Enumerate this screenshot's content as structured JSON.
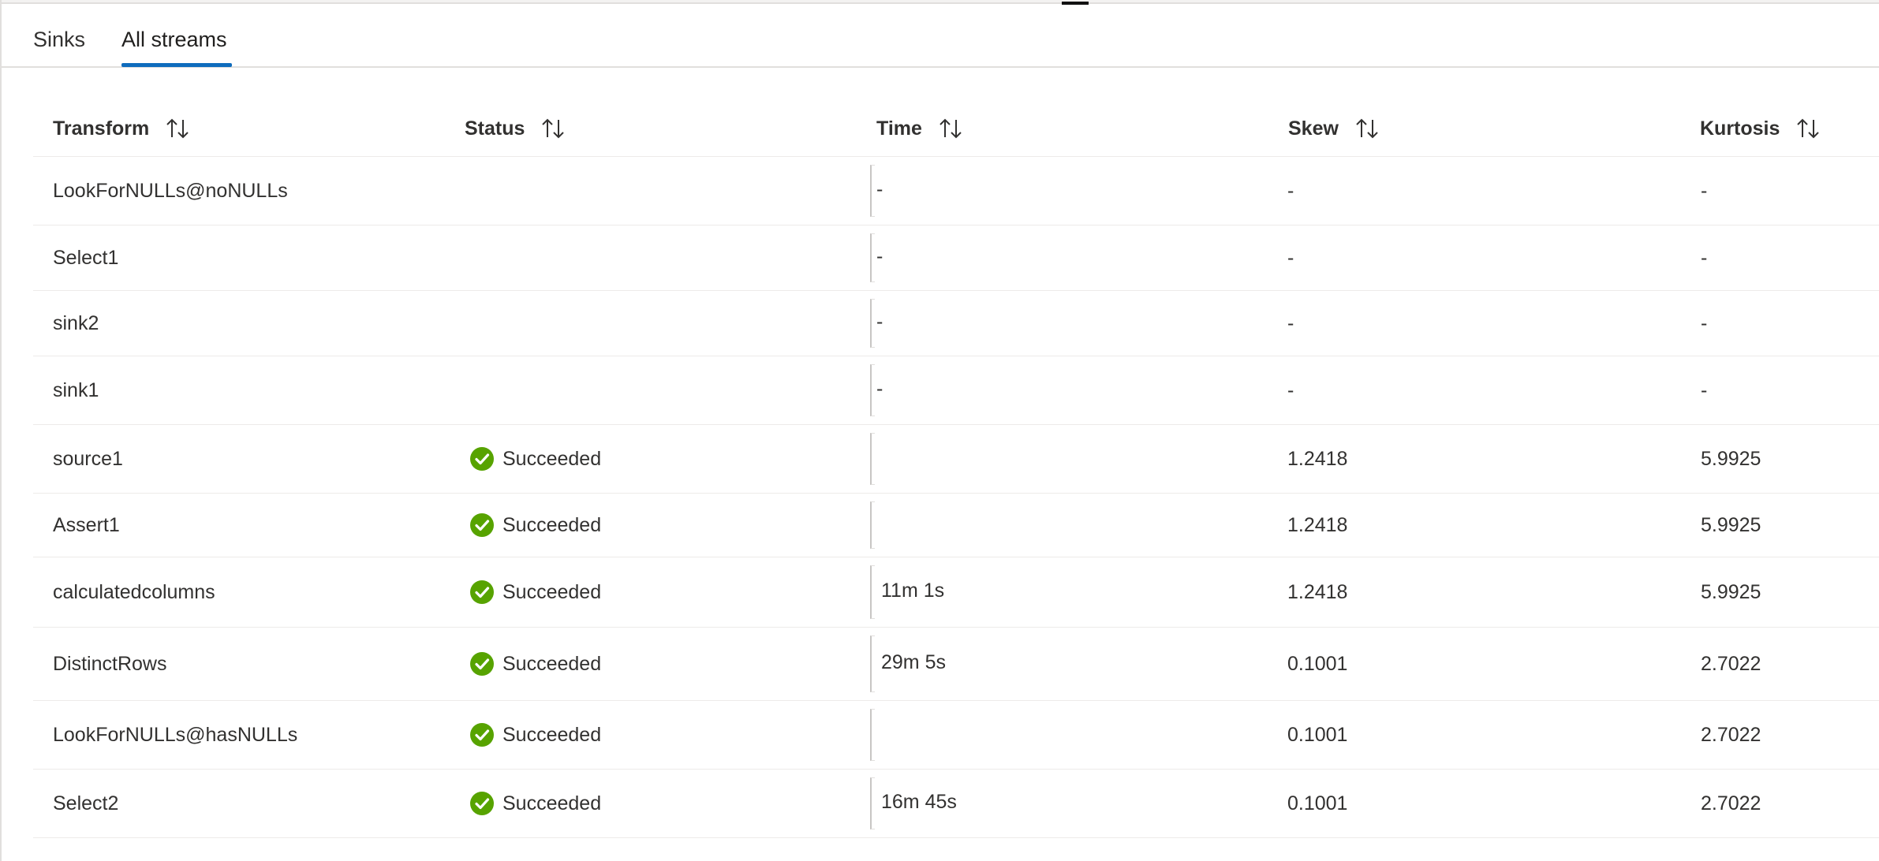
{
  "tabs": [
    {
      "label": "Sinks"
    },
    {
      "label": "All streams"
    }
  ],
  "columns": {
    "transform": "Transform",
    "status": "Status",
    "time": "Time",
    "skew": "Skew",
    "kurtosis": "Kurtosis"
  },
  "rows": [
    {
      "transform": "LookForNULLs@noNULLs",
      "status": "",
      "time": "-",
      "skew": "-",
      "kurtosis": "-"
    },
    {
      "transform": "Select1",
      "status": "",
      "time": "-",
      "skew": "-",
      "kurtosis": "-"
    },
    {
      "transform": "sink2",
      "status": "",
      "time": "-",
      "skew": "-",
      "kurtosis": "-"
    },
    {
      "transform": "sink1",
      "status": "",
      "time": "-",
      "skew": "-",
      "kurtosis": "-"
    },
    {
      "transform": "source1",
      "status": "Succeeded",
      "time": "",
      "skew": "1.2418",
      "kurtosis": "5.9925"
    },
    {
      "transform": "Assert1",
      "status": "Succeeded",
      "time": "",
      "skew": "1.2418",
      "kurtosis": "5.9925"
    },
    {
      "transform": "calculatedcolumns",
      "status": "Succeeded",
      "time": "11m 1s",
      "skew": "1.2418",
      "kurtosis": "5.9925"
    },
    {
      "transform": "DistinctRows",
      "status": "Succeeded",
      "time": "29m 5s",
      "skew": "0.1001",
      "kurtosis": "2.7022"
    },
    {
      "transform": "LookForNULLs@hasNULLs",
      "status": "Succeeded",
      "time": "",
      "skew": "0.1001",
      "kurtosis": "2.7022"
    },
    {
      "transform": "Select2",
      "status": "Succeeded",
      "time": "16m 45s",
      "skew": "0.1001",
      "kurtosis": "2.7022"
    }
  ],
  "colors": {
    "accent": "#0f6cbd",
    "success": "#57a300"
  },
  "icons": {
    "sort": "sort-arrows-icon",
    "status_success": "check-circle-icon"
  }
}
